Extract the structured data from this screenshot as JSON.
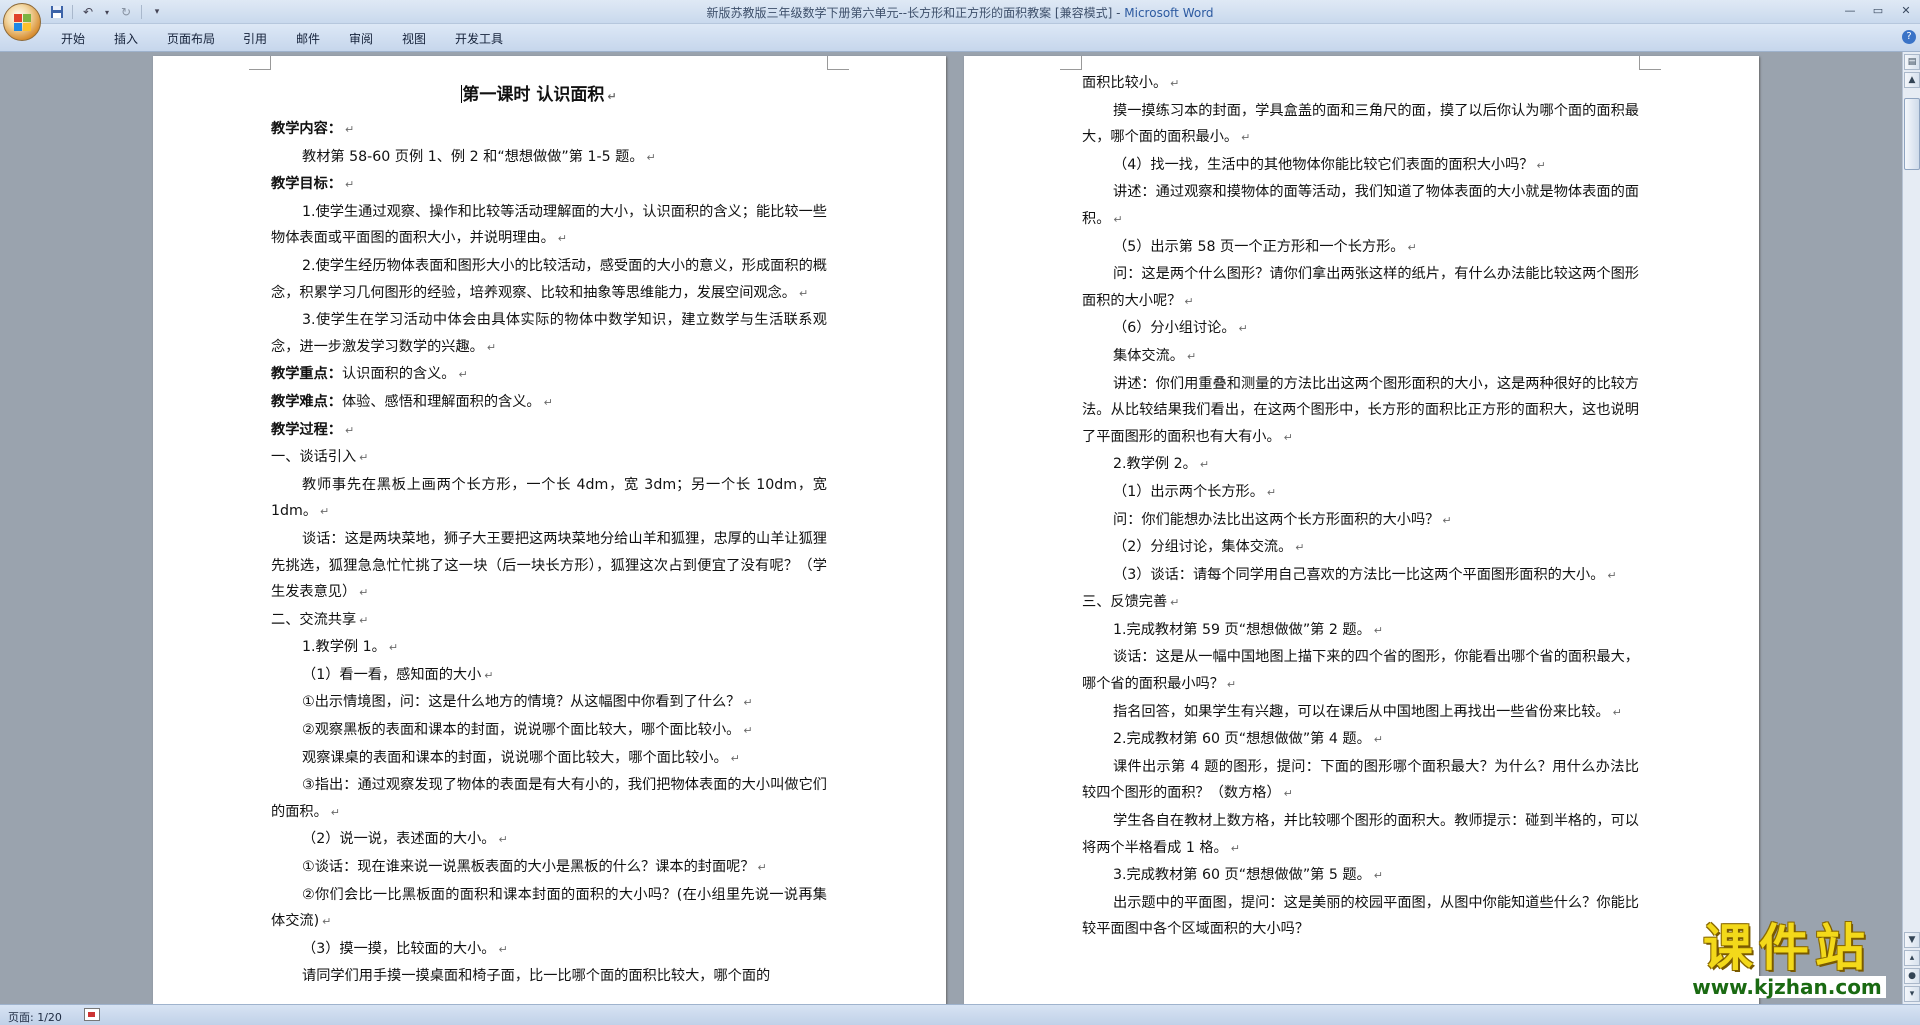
{
  "window": {
    "title": "新版苏教版三年级数学下册第六单元--长方形和正方形的面积教案 [兼容模式] - ",
    "app": "Microsoft Word"
  },
  "ribbon": {
    "tabs": [
      "开始",
      "插入",
      "页面布局",
      "引用",
      "邮件",
      "审阅",
      "视图",
      "开发工具"
    ]
  },
  "icons": {
    "office": "office-button-icon",
    "save": "save-icon",
    "undo": "undo-icon",
    "redo": "redo-icon",
    "customize": "qat-dropdown-icon"
  },
  "status": {
    "page": "页面: 1/20"
  },
  "watermark": {
    "main": "课件站",
    "url": "www.kjzhan.com"
  },
  "page1": {
    "title": "第一课时 认识面积",
    "content_label": "教学内容：",
    "content": "教材第 58-60 页例 1、例 2 和“想想做做”第 1-5 题。",
    "goals_label": "教学目标：",
    "goal1": "1.使学生通过观察、操作和比较等活动理解面的大小，认识面积的含义；能比较一些物体表面或平面图的面积大小，并说明理由。",
    "goal2": "2.使学生经历物体表面和图形大小的比较活动，感受面的大小的意义，形成面积的概念，积累学习几何图形的经验，培养观察、比较和抽象等思维能力，发展空间观念。",
    "goal3": "3.使学生在学习活动中体会由具体实际的物体中数学知识，建立数学与生活联系观念，进一步激发学习数学的兴趣。",
    "key_label": "教学重点：",
    "key": "认识面积的含义。",
    "difficulty_label": "教学难点：",
    "difficulty": "体验、感悟和理解面积的含义。",
    "process_label": "教学过程：",
    "s1": "一、谈话引入",
    "p1": "教师事先在黑板上画两个长方形，一个长 4dm，宽 3dm；另一个长 10dm，宽 1dm。",
    "p2": "谈话：这是两块菜地，狮子大王要把这两块菜地分给山羊和狐狸，忠厚的山羊让狐狸先挑选，狐狸急急忙忙挑了这一块（后一块长方形），狐狸这次占到便宜了没有呢？（学生发表意见）",
    "s2": "二、交流共享",
    "p3": "1.教学例 1。",
    "p4": "（1）看一看，感知面的大小",
    "p5": "①出示情境图，问：这是什么地方的情境？从这幅图中你看到了什么？",
    "p6": "②观察黑板的表面和课本的封面，说说哪个面比较大，哪个面比较小。",
    "p7": "观察课桌的表面和课本的封面，说说哪个面比较大，哪个面比较小。",
    "p8": "③指出：通过观察发现了物体的表面是有大有小的，我们把物体表面的大小叫做它们的面积。",
    "p9": "（2）说一说，表述面的大小。",
    "p10": "①谈话：现在谁来说一说黑板表面的大小是黑板的什么？课本的封面呢？",
    "p11": "②你们会比一比黑板面的面积和课本封面的面积的大小吗？(在小组里先说一说再集体交流)",
    "p12": "（3）摸一摸，比较面的大小。",
    "p13": "请同学们用手摸一摸桌面和椅子面，比一比哪个面的面积比较大，哪个面的"
  },
  "page2": {
    "q1": "面积比较小。",
    "q2": "摸一摸练习本的封面，学具盒盖的面和三角尺的面，摸了以后你认为哪个面的面积最大，哪个面的面积最小。",
    "q3": "（4）找一找，生活中的其他物体你能比较它们表面的面积大小吗？",
    "q4": "讲述：通过观察和摸物体的面等活动，我们知道了物体表面的大小就是物体表面的面积。",
    "q5": "（5）出示第 58 页一个正方形和一个长方形。",
    "q6": "问：这是两个什么图形？请你们拿出两张这样的纸片，有什么办法能比较这两个图形面积的大小呢？",
    "q7": "（6）分小组讨论。",
    "q8": "集体交流。",
    "q9": "讲述：你们用重叠和测量的方法比出这两个图形面积的大小，这是两种很好的比较方法。从比较结果我们看出，在这两个图形中，长方形的面积比正方形的面积大，这也说明了平面图形的面积也有大有小。",
    "q10": "2.教学例 2。",
    "q11": "（1）出示两个长方形。",
    "q12": "问：你们能想办法比出这两个长方形面积的大小吗？",
    "q13": "（2）分组讨论，集体交流。",
    "q14": "（3）谈话：请每个同学用自己喜欢的方法比一比这两个平面图形面积的大小。",
    "q15": "三、反馈完善",
    "q16": "1.完成教材第 59 页“想想做做”第 2 题。",
    "q17": "谈话：这是从一幅中国地图上描下来的四个省的图形，你能看出哪个省的面积最大，哪个省的面积最小吗？",
    "q18": "指名回答，如果学生有兴趣，可以在课后从中国地图上再找出一些省份来比较。",
    "q19": "2.完成教材第 60 页“想想做做”第 4 题。",
    "q20": "课件出示第 4 题的图形，提问：下面的图形哪个面积最大？为什么？用什么办法比较四个图形的面积？（数方格）",
    "q21": "学生各自在教材上数方格，并比较哪个图形的面积大。教师提示：碰到半格的，可以将两个半格看成 1 格。",
    "q22": "3.完成教材第 60 页“想想做做”第 5 题。",
    "q23": "出示题中的平面图，提问：这是美丽的校园平面图，从图中你能知道些什么？你能比较平面图中各个区域面积的大小吗？"
  },
  "marks": {
    "para": "↵"
  }
}
